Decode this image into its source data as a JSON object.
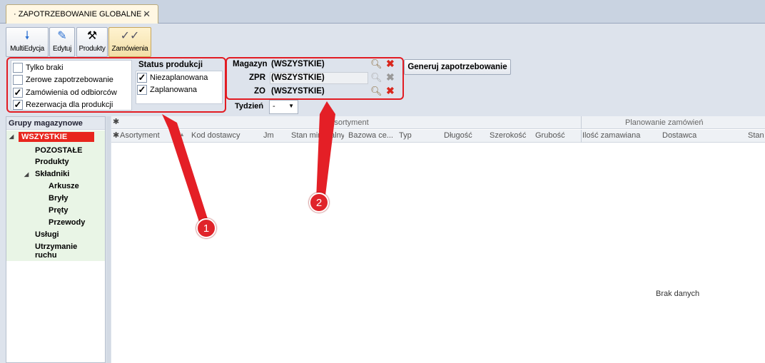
{
  "tab": {
    "title": "· ZAPOTRZEBOWANIE GLOBALNE ·",
    "close": "✕"
  },
  "toolbar": [
    {
      "label": "MultiEdycja",
      "icon": "arrow-down-icon"
    },
    {
      "label": "Edytuj",
      "icon": "pencil-icon"
    },
    {
      "label": "Produkty",
      "icon": "tools-icon"
    },
    {
      "label": "Zamówienia",
      "icon": "orders-icon"
    }
  ],
  "filters": {
    "tylko_braki": "Tylko braki",
    "zerowe": "Zerowe zapotrzebowanie",
    "zamowienia": "Zamówienia od odbiorców",
    "rezerwacja": "Rezerwacja dla produkcji"
  },
  "status": {
    "title": "Status produkcji",
    "niezaplanowana": "Niezaplanowana",
    "zaplanowana": "Zaplanowana"
  },
  "selectors": [
    {
      "label": "Magazyn",
      "value": "(WSZYSTKIE)"
    },
    {
      "label": "ZPR",
      "value": "(WSZYSTKIE)"
    },
    {
      "label": "ZO",
      "value": "(WSZYSTKIE)"
    }
  ],
  "generate_label": "Generuj zapotrzebowanie",
  "week": {
    "label": "Tydzień",
    "value": "-"
  },
  "groups": {
    "title": "Grupy magazynowe",
    "items": [
      "WSZYSTKIE",
      "POZOSTAŁE",
      "Produkty",
      "Składniki",
      "Arkusze",
      "Bryły",
      "Pręty",
      "Przewody",
      "Usługi",
      "Utrzymanie ruchu"
    ]
  },
  "grid": {
    "band_assort": "Asortyment",
    "band_plan": "Planowanie zamówień",
    "cols": [
      "Asortyment",
      "Kod dostawcy",
      "Jm",
      "Stan minimalny",
      "Bazowa ce...",
      "Typ",
      "Długość",
      "Szerokość",
      "Grubość",
      "Ilość zamawiana",
      "Dostawca",
      "Stan"
    ],
    "empty": "Brak danych"
  },
  "callouts": [
    "1",
    "2"
  ],
  "icons": {
    "search": "magnifier-icon",
    "clear": "clear-x-icon"
  }
}
